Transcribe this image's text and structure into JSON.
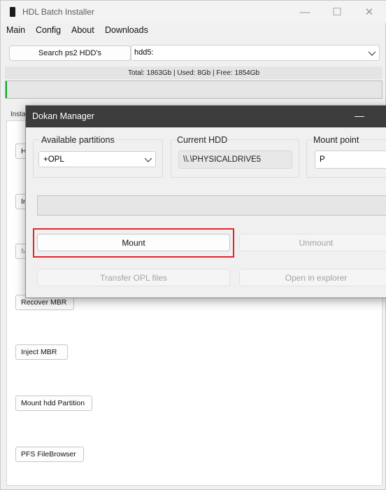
{
  "main_window": {
    "title": "HDL Batch Installer",
    "controls": {
      "minimize": "—",
      "maximize": "☐",
      "close": "✕"
    },
    "menu": [
      "Main",
      "Config",
      "About",
      "Downloads"
    ],
    "search_button": "Search ps2 HDD's",
    "hdd_select": {
      "value": "hdd5:"
    },
    "summary": "Total: 1863Gb | Used: 8Gb | Free: 1854Gb",
    "progress": 0.0,
    "tab_label": "Insta",
    "partial_buttons": [
      "H",
      "In",
      "M"
    ],
    "buttons": {
      "recover_mbr": "Recover MBR",
      "inject_mbr": "Inject MBR",
      "mount_hdd_partition": "Mount hdd Partition",
      "pfs_filebrowser": "PFS FileBrowser"
    }
  },
  "dokan": {
    "title": "Dokan Manager",
    "minimize": "—",
    "available_partitions": {
      "label": "Available partitions",
      "value": "+OPL"
    },
    "current_hdd": {
      "label": "Current HDD",
      "value": "\\\\.\\PHYSICALDRIVE5"
    },
    "mount_point": {
      "label": "Mount point",
      "value": "P"
    },
    "progress": 0.0,
    "buttons": {
      "mount": "Mount",
      "unmount": "Unmount",
      "transfer_opl": "Transfer OPL files",
      "open_explorer": "Open in explorer"
    }
  },
  "colors": {
    "progress_green": "#06b025",
    "highlight": "#e0262d",
    "dokan_titlebar": "#3c3c3c"
  }
}
